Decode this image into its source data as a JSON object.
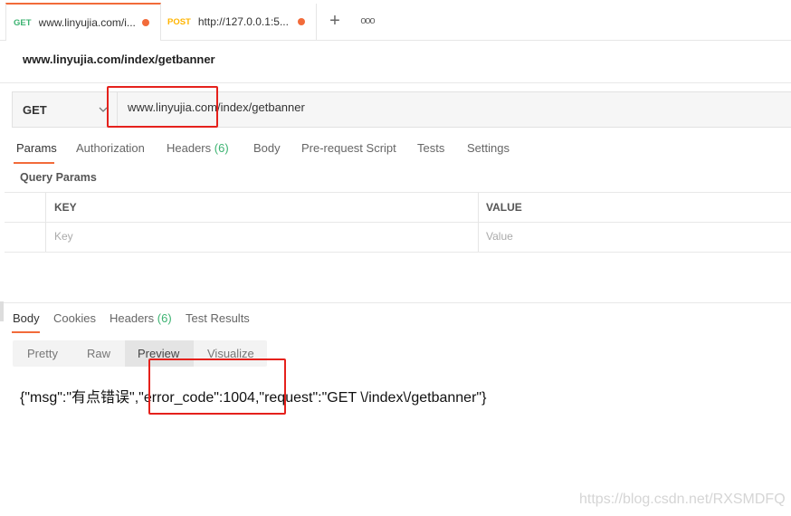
{
  "tabs": [
    {
      "method": "GET",
      "title": "www.linyujia.com/i...",
      "method_color": "#3cb371"
    },
    {
      "method": "POST",
      "title": "http://127.0.0.1:5...",
      "method_color": "#ffb400"
    }
  ],
  "tab_actions": {
    "new_tab": "+",
    "more": "ooo"
  },
  "request": {
    "name": "www.linyujia.com/index/getbanner",
    "method": "GET",
    "url": "www.linyujia.com/index/getbanner"
  },
  "request_tabs": {
    "params": "Params",
    "authorization": "Authorization",
    "headers": "Headers",
    "headers_count": "(6)",
    "body": "Body",
    "pre_request": "Pre-request Script",
    "tests": "Tests",
    "settings": "Settings"
  },
  "query_params": {
    "title": "Query Params",
    "columns": [
      "KEY",
      "VALUE"
    ],
    "placeholders": [
      "Key",
      "Value"
    ]
  },
  "response_tabs": {
    "body": "Body",
    "cookies": "Cookies",
    "headers": "Headers",
    "headers_count": "(6)",
    "test_results": "Test Results"
  },
  "view_modes": [
    "Pretty",
    "Raw",
    "Preview",
    "Visualize"
  ],
  "response_body": "{\"msg\":\"有点错误\",\"error_code\":1004,\"request\":\"GET \\/index\\/getbanner\"}",
  "watermark": "https://blog.csdn.net/RXSMDFQ",
  "colors": {
    "accent": "#f26b3a",
    "get": "#3cb371",
    "post": "#ffb400",
    "highlight_box": "#e5211c"
  }
}
